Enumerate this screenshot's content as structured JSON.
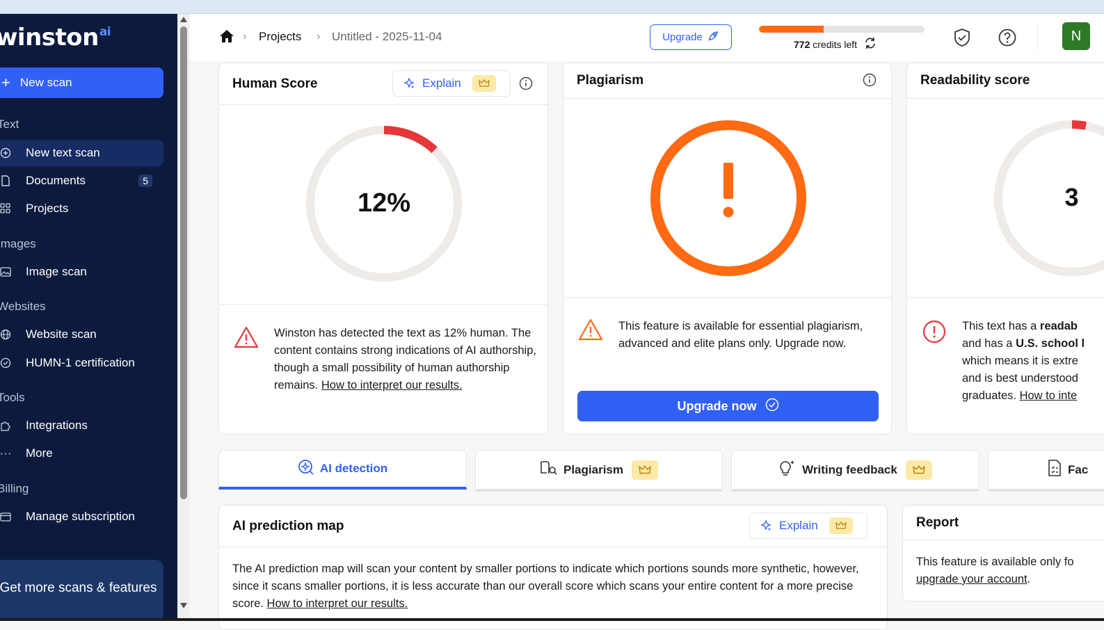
{
  "sidebar": {
    "logo_text": "winston",
    "logo_sup": "ai",
    "new_scan_label": "New scan",
    "sections": {
      "text": "Text",
      "images": "Images",
      "websites": "Websites",
      "tools": "Tools",
      "billing": "Billing"
    },
    "items": {
      "new_text_scan": "New text scan",
      "documents": "Documents",
      "documents_count": "5",
      "projects": "Projects",
      "image_scan": "Image scan",
      "website_scan": "Website scan",
      "humn_cert": "HUMN-1 certification",
      "integrations": "Integrations",
      "more": "More",
      "manage_subscription": "Manage subscription"
    },
    "promo_text": "Get more scans & features"
  },
  "header": {
    "breadcrumb_projects": "Projects",
    "breadcrumb_current": "Untitled - 2025-11-04",
    "upgrade_label": "Upgrade",
    "credits_value": "772",
    "credits_suffix": "credits left",
    "credits_fraction": 0.39,
    "avatar_initial": "N"
  },
  "human_score": {
    "title": "Human Score",
    "explain_label": "Explain",
    "score_label": "12%",
    "score_fraction": 0.12,
    "body": "Winston has detected the text as 12% human. The content contains strong indications of AI authorship, though a small possibility of human authorship remains.",
    "link": "How to interpret our results."
  },
  "plagiarism": {
    "title": "Plagiarism",
    "body": "This feature is available for essential plagiarism, advanced and elite plans only. Upgrade now.",
    "button": "Upgrade now"
  },
  "readability": {
    "title": "Readability score",
    "score_label": "3",
    "body_1": "This text has a",
    "body_1_bold": "readab",
    "body_2": "and has a",
    "body_2_bold": "U.S. school l",
    "body_3": "which means it is extre",
    "body_4": "and is best understood",
    "body_5": "graduates.",
    "link": "How to inte"
  },
  "tabs": {
    "ai_detection": "AI detection",
    "plagiarism": "Plagiarism",
    "writing_feedback": "Writing feedback",
    "fact": "Fac"
  },
  "prediction_map": {
    "title": "AI prediction map",
    "explain_label": "Explain",
    "body": "The AI prediction map will scan your content by smaller portions to indicate which portions sounds more synthetic, however, since it scans smaller portions, it is less accurate than our overall score which scans your entire content for a more precise score.",
    "link": "How to interpret our results."
  },
  "report": {
    "title": "Report",
    "body": "This feature is available only fo",
    "link": "upgrade your account",
    "suffix": "."
  },
  "colors": {
    "accent": "#3160f5",
    "sidebar_bg": "#0c1b3d",
    "warning_orange": "#ff6a13",
    "danger_red": "#e5383b"
  }
}
